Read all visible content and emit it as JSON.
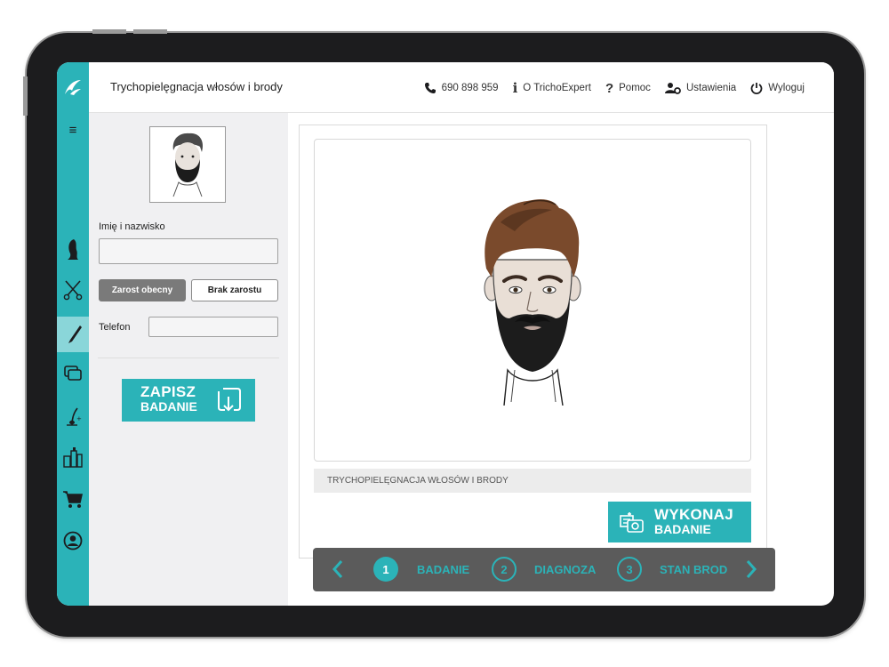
{
  "app": {
    "title": "Trychopielęgnacja włosów i brody"
  },
  "topnav": {
    "phone": "690 898 959",
    "about": "O TrichoExpert",
    "help": "Pomoc",
    "settings": "Ustawienia",
    "logout": "Wyloguj"
  },
  "rail": {
    "menu_icon": "≡",
    "items": [
      "hair-profile-icon",
      "scissors-icon",
      "razor-icon",
      "gallery-icon",
      "hair-growth-icon",
      "products-icon",
      "cart-icon",
      "user-icon"
    ],
    "active": "razor-icon"
  },
  "form": {
    "name_label": "Imię i nazwisko",
    "name_value": "",
    "beard_present": "Zarost obecny",
    "beard_absent": "Brak zarostu",
    "beard_selected": "Zarost obecny",
    "phone_label": "Telefon",
    "phone_value": "",
    "save_line1": "ZAPISZ",
    "save_line2": "BADANIE"
  },
  "main": {
    "caption": "TRYCHOPIELĘGNACJA WŁOSÓW I BRODY",
    "exam_line1": "WYKONAJ",
    "exam_line2": "BADANIE"
  },
  "steps": [
    {
      "num": "1",
      "label": "BADANIE",
      "active": true
    },
    {
      "num": "2",
      "label": "DIAGNOZA",
      "active": false
    },
    {
      "num": "3",
      "label": "STAN BROD",
      "active": false
    }
  ],
  "colors": {
    "accent": "#2bb3b8",
    "accent_light": "#8ad6d9",
    "stepper_bg": "#5b5b5b"
  }
}
